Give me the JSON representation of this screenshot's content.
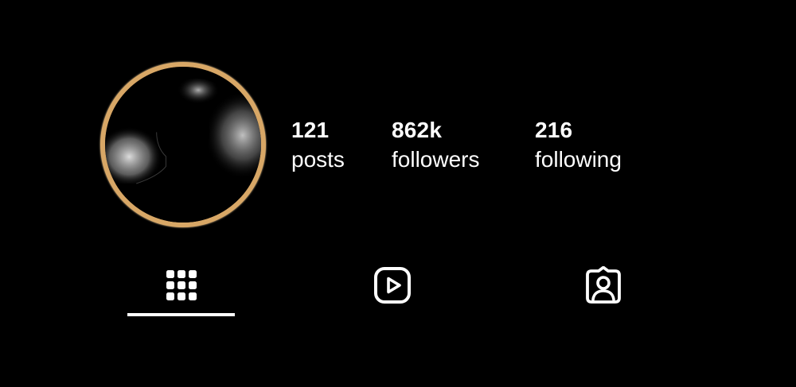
{
  "profile": {
    "avatar_icon": "person-silhouette-smoke",
    "ring_color": "#d8a766"
  },
  "stats": {
    "posts": {
      "value": "121",
      "label": "posts"
    },
    "followers": {
      "value": "862k",
      "label": "followers"
    },
    "following": {
      "value": "216",
      "label": "following"
    }
  },
  "tabs": {
    "active": "grid",
    "items": [
      {
        "id": "grid",
        "icon": "grid-icon"
      },
      {
        "id": "reels",
        "icon": "reels-play-icon"
      },
      {
        "id": "tagged",
        "icon": "tagged-person-icon"
      }
    ]
  },
  "colors": {
    "background": "#000000",
    "text": "#ffffff",
    "accent_ring": "#d8a766"
  }
}
